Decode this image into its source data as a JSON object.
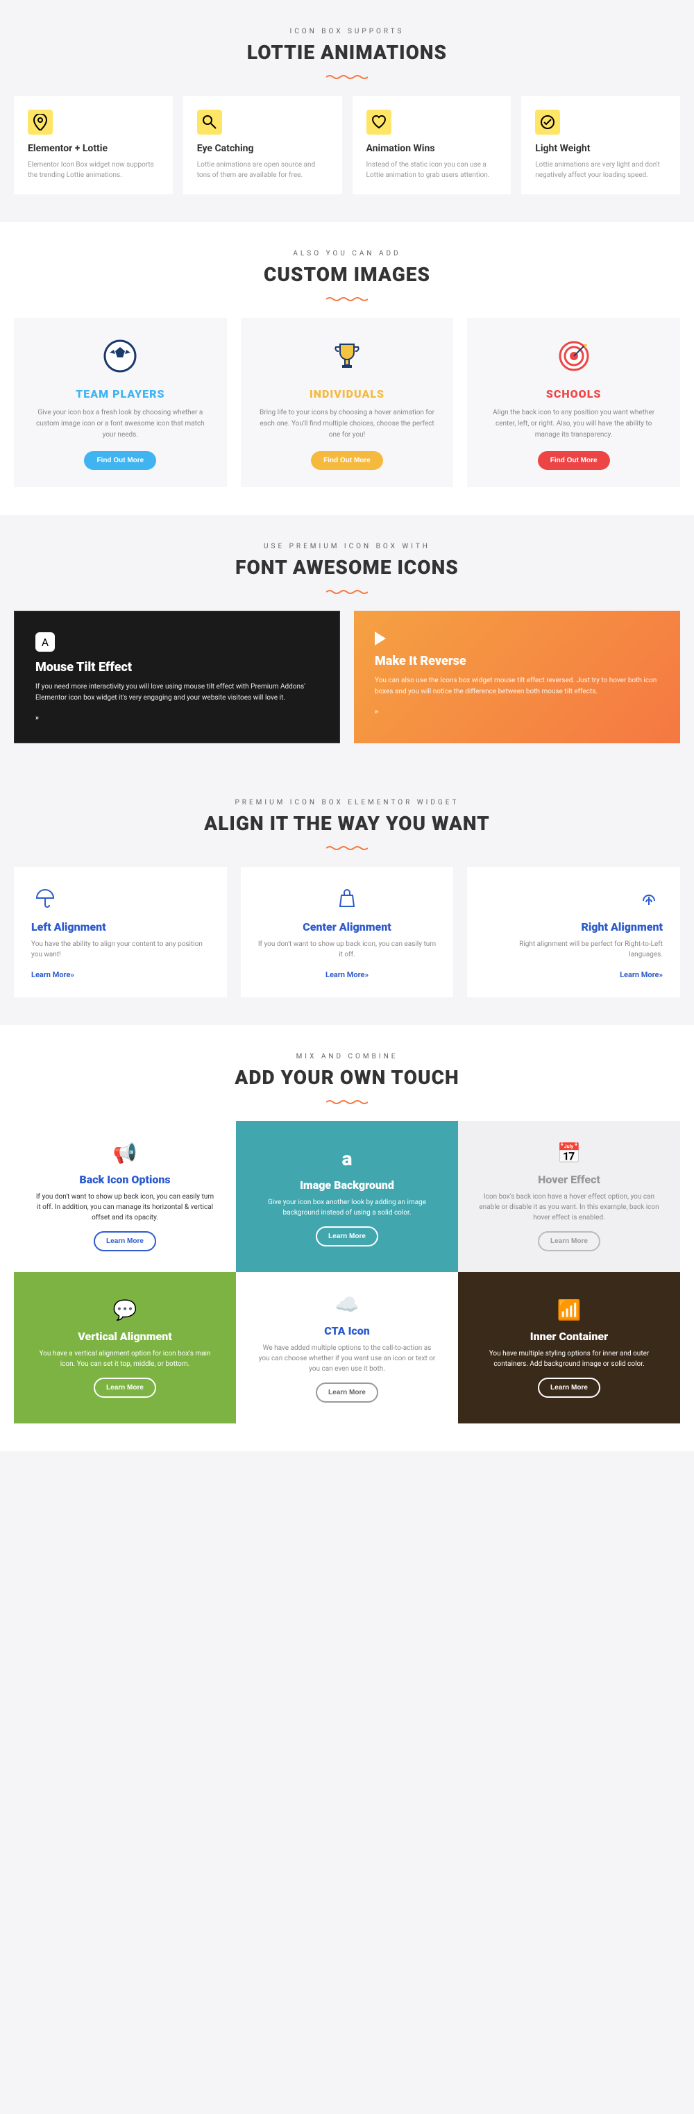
{
  "s1": {
    "eyebrow": "ICON BOX SUPPORTS",
    "heading": "LOTTIE ANIMATIONS",
    "cards": [
      {
        "title": "Elementor + Lottie",
        "desc": "Elementor Icon Box widget now supports the trending Lottie animations."
      },
      {
        "title": "Eye Catching",
        "desc": "Lottie animations are open source and tons of them are available for free."
      },
      {
        "title": "Animation Wins",
        "desc": "Instead of the static icon you can use a Lottie animation to grab users attention."
      },
      {
        "title": "Light Weight",
        "desc": "Lottie animations are very light and don't negatively affect your loading speed."
      }
    ]
  },
  "s2": {
    "eyebrow": "ALSO YOU CAN ADD",
    "heading": "CUSTOM IMAGES",
    "cards": [
      {
        "title": "TEAM PLAYERS",
        "color": "#3fb4f0",
        "desc": "Give your icon box a fresh look by choosing whether a custom image icon or a font awesome icon that match your needs.",
        "btn": "Find Out More"
      },
      {
        "title": "INDIVIDUALS",
        "color": "#f5b93e",
        "desc": "Bring life to your icons by choosing a hover animation for each one. You'll find multiple choices, choose the perfect one for you!",
        "btn": "Find Out More"
      },
      {
        "title": "SCHOOLS",
        "color": "#ed4545",
        "desc": "Align the back icon to any position you want whether center, left, or right. Also, you will have the ability to manage its transparency.",
        "btn": "Find Out More"
      }
    ]
  },
  "s3": {
    "eyebrow": "USE PREMIUM ICON BOX WITH",
    "heading": "FONT AWESOME ICONS",
    "cards": [
      {
        "title": "Mouse Tilt Effect",
        "desc": "If you need more interactivity you will love using mouse tilt effect with Premium Addons' Elementor icon box widget it's very engaging and your website visitoes will love it."
      },
      {
        "title": "Make It Reverse",
        "desc": "You can also use the Icons box widget mouse tilt effect reversed. Just try to hover both icon boxes and you will notice the difference between both mouse tilt effects."
      }
    ],
    "arrow": "»"
  },
  "s4": {
    "eyebrow": "PREMIUM ICON BOX ELEMENTOR WIDGET",
    "heading": "ALIGN IT THE WAY YOU WANT",
    "cards": [
      {
        "title": "Left Alignment",
        "desc": "You have the ability to align your content to any position you want!",
        "link": "Learn More»"
      },
      {
        "title": "Center Alignment",
        "desc": "If you don't want to show up back icon, you can easily turn it off.",
        "link": "Learn More»"
      },
      {
        "title": "Right Alignment",
        "desc": "Right alignment will be perfect for Right-to-Left languages.",
        "link": "Learn More»"
      }
    ]
  },
  "s5": {
    "eyebrow": "MIX AND COMBINE",
    "heading": "ADD YOUR OWN TOUCH",
    "cards": [
      {
        "title": "Back Icon Options",
        "desc": "If you don't want to show up back icon, you can easily turn it off. In addition, you can manage its horizontal & vertical offset and its opacity.",
        "btn": "Learn More"
      },
      {
        "title": "Image Background",
        "desc": "Give your icon box another look by adding an image background instead of using a solid color.",
        "btn": "Learn More"
      },
      {
        "title": "Hover Effect",
        "desc": "Icon box's back icon have a hover effect option, you can enable or disable it as you want. In this example, back icon hover effect is enabled.",
        "btn": "Learn More"
      },
      {
        "title": "Vertical Alignment",
        "desc": "You have a vertical alignment option for icon box's main icon. You can set it top, middle, or bottom.",
        "btn": "Learn More"
      },
      {
        "title": "CTA Icon",
        "desc": "We have added multiple options to the call-to-action as you can choose whether if you want use an icon or text or you can even use it both.",
        "btn": "Learn More"
      },
      {
        "title": "Inner Container",
        "desc": "You have multiple styling options for inner and outer containers. Add background image or solid color.",
        "btn": "Learn More"
      }
    ]
  }
}
